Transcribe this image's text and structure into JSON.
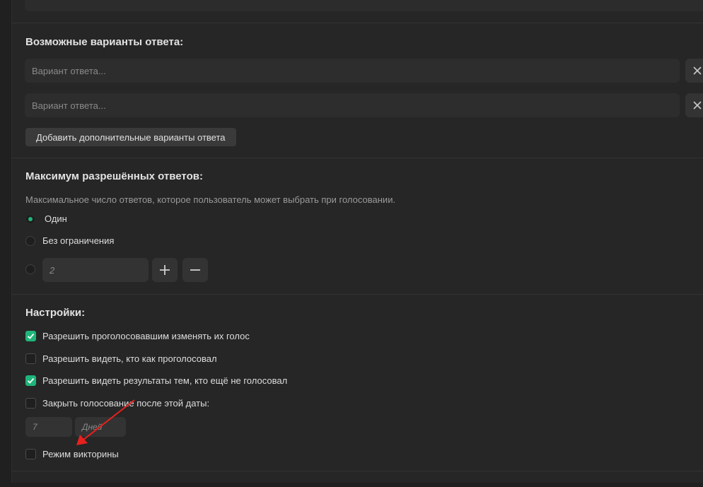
{
  "answers": {
    "title": "Возможные варианты ответа:",
    "options": [
      {
        "placeholder": "Вариант ответа..."
      },
      {
        "placeholder": "Вариант ответа..."
      }
    ],
    "add_label": "Добавить дополнительные варианты ответа",
    "remove_icon": "close-icon"
  },
  "max_answers": {
    "title": "Максимум разрешённых ответов:",
    "description": "Максимальное число ответов, которое пользователь может выбрать при голосовании.",
    "options": [
      {
        "label": "Один",
        "selected": true
      },
      {
        "label": "Без ограничения",
        "selected": false
      }
    ],
    "custom_value_placeholder": "2",
    "plus_icon": "plus-icon",
    "minus_icon": "minus-icon"
  },
  "settings": {
    "title": "Настройки:",
    "options": [
      {
        "label": "Разрешить проголосовавшим изменять их голос",
        "checked": true
      },
      {
        "label": "Разрешить видеть, кто как проголосовал",
        "checked": false
      },
      {
        "label": "Разрешить видеть результаты тем, кто ещё не голосовал",
        "checked": true
      },
      {
        "label": "Закрыть голосование после этой даты:",
        "checked": false
      }
    ],
    "close_value_placeholder": "7",
    "close_unit_placeholder": "Дней",
    "quiz_label": "Режим викторины",
    "quiz_checked": false
  },
  "colors": {
    "accent": "#1fb57a",
    "annotation_arrow": "#e8201e"
  }
}
